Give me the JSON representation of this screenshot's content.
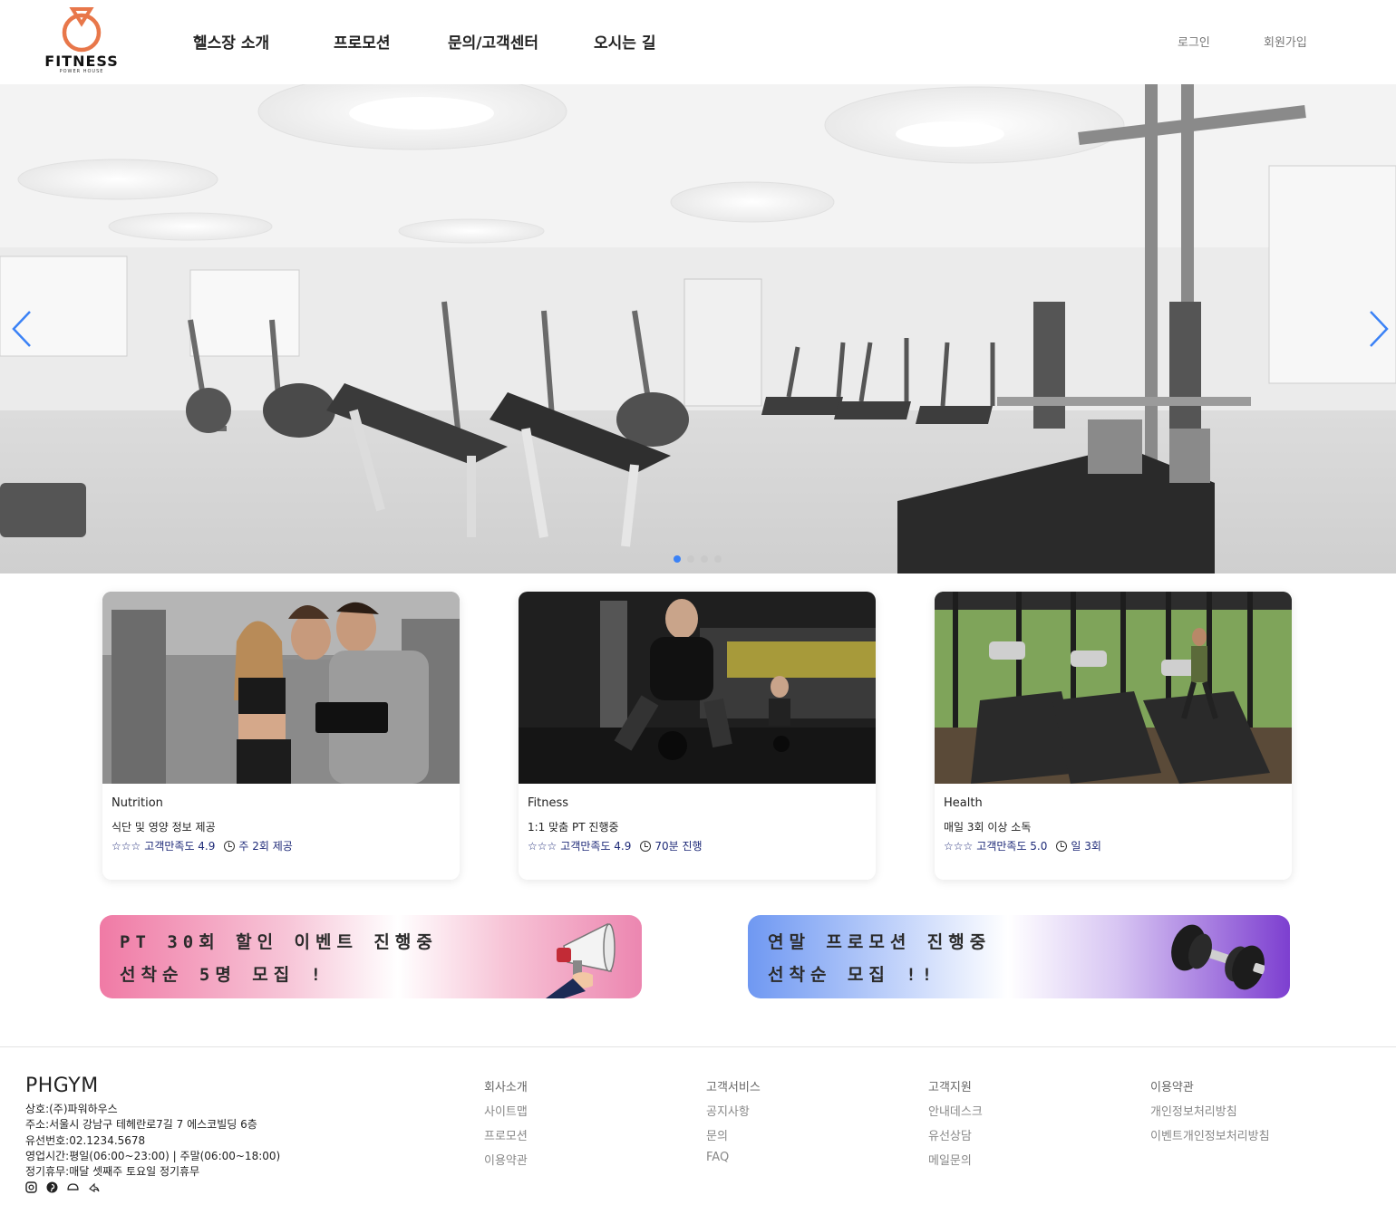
{
  "logo": {
    "name": "FITNESS",
    "sub": "POWER HOUSE"
  },
  "nav": [
    "헬스장 소개",
    "프로모션",
    "문의/고객센터",
    "오시는 길"
  ],
  "auth": {
    "login": "로그인",
    "signup": "회원가입"
  },
  "hero": {
    "slides": 4,
    "active_slide": 1
  },
  "cards": [
    {
      "category": "Nutrition",
      "title": "식단 및 영양 정보 제공",
      "stars": "☆☆☆",
      "rating_label": "고객만족도 4.9",
      "schedule": "주 2회 제공"
    },
    {
      "category": "Fitness",
      "title": "1:1 맞춤 PT 진행중",
      "stars": "☆☆☆",
      "rating_label": "고객만족도 4.9",
      "schedule": "70분 진행"
    },
    {
      "category": "Health",
      "title": "매일 3회 이상 소독",
      "stars": "☆☆☆",
      "rating_label": "고객만족도 5.0",
      "schedule": "일 3회"
    }
  ],
  "banners": [
    {
      "line1": "PT 30회 할인 이벤트 진행중",
      "line2": "선착순 5명 모집 !",
      "icon": "megaphone-icon"
    },
    {
      "line1": "연말 프로모션 진행중",
      "line2": "선착순 모집 !!",
      "icon": "dumbbell-icon"
    }
  ],
  "footer": {
    "brand": "PHGYM",
    "info": [
      "상호:(주)파워하우스",
      "주소:서울시 강남구 테헤란로7길 7 에스코빌딩 6층",
      "유선번호:02.1234.5678",
      "영업시간:평일(06:00~23:00) | 주말(06:00~18:00)",
      "정기휴무:매달 셋째주 토요일 정기휴무"
    ],
    "social_icons": [
      "instagram-icon",
      "pinterest-icon",
      "chat-icon",
      "share-icon"
    ],
    "columns": [
      {
        "head": "회사소개",
        "links": [
          "사이트맵",
          "프로모션",
          "이용약관"
        ]
      },
      {
        "head": "고객서비스",
        "links": [
          "공지사항",
          "문의",
          "FAQ"
        ]
      },
      {
        "head": "고객지원",
        "links": [
          "안내데스크",
          "유선상담",
          "메일문의"
        ]
      },
      {
        "head": "이용약관",
        "links": [
          "개인정보처리방침",
          "이벤트개인정보처리방침"
        ]
      }
    ]
  },
  "colors": {
    "accent": "#e8774a",
    "dot_active": "#3b82f6",
    "meta_text": "#1e2a78"
  }
}
